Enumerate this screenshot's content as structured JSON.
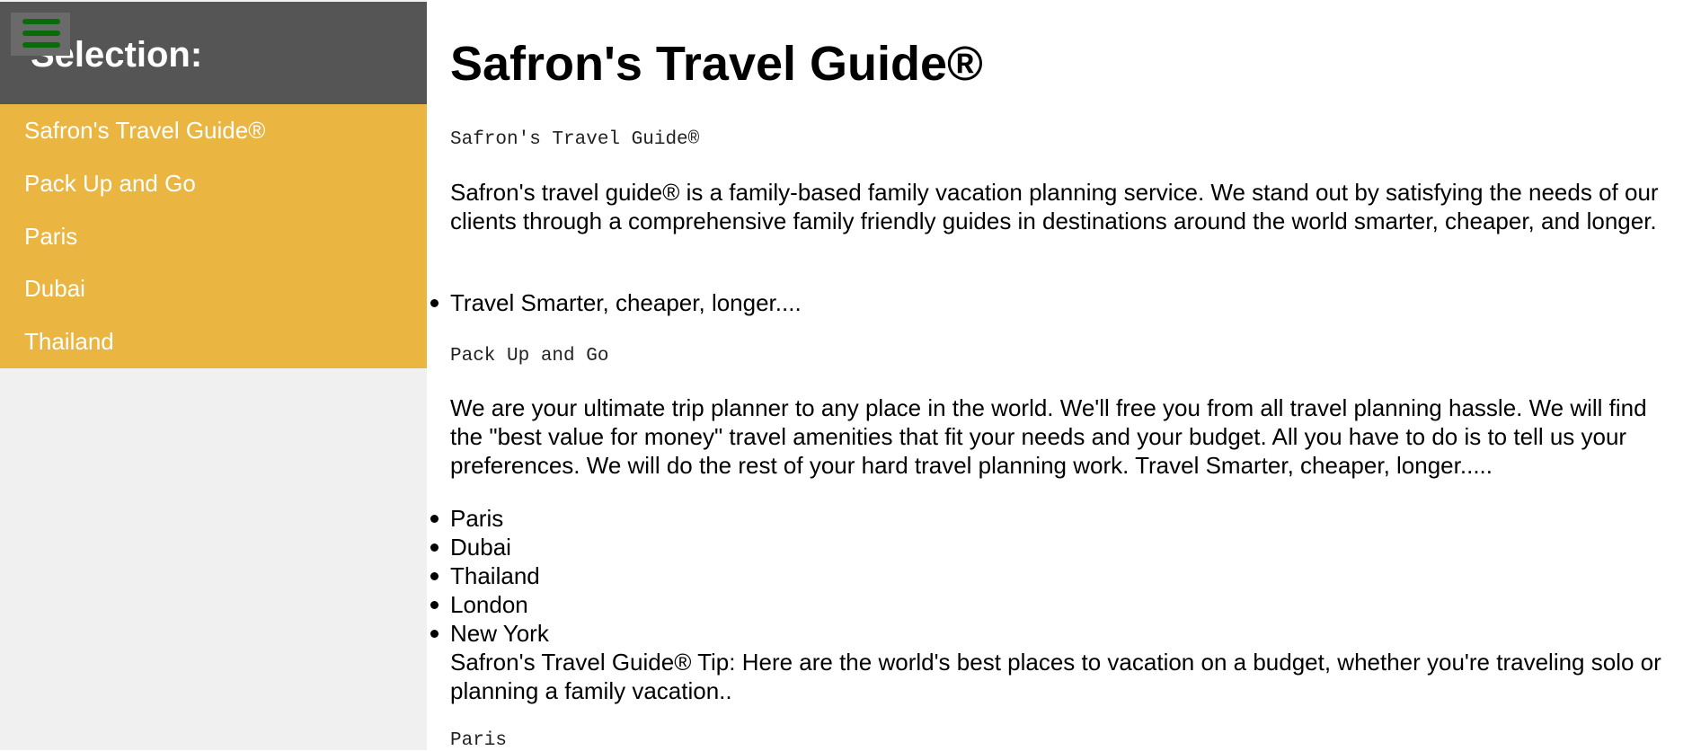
{
  "sidebar": {
    "title": "Selection:",
    "menu_icon": "hamburger-menu-icon",
    "items": [
      {
        "label": "Safron's Travel Guide®"
      },
      {
        "label": "Pack Up and Go"
      },
      {
        "label": "Paris"
      },
      {
        "label": "Dubai"
      },
      {
        "label": "Thailand"
      }
    ]
  },
  "main": {
    "title": "Safron's Travel Guide®",
    "section1_heading": "Safron's Travel Guide®",
    "section1_text": "Safron's travel guide® is a family-based family vacation planning service. We stand out by satisfying the needs of our clients through a comprehensive family friendly guides in destinations around the world smarter, cheaper, and longer.",
    "section1_bullets": [
      "Travel Smarter, cheaper, longer...."
    ],
    "section2_heading": "Pack Up and Go",
    "section2_text": "We are your ultimate trip planner to any place in the world. We'll free you from all travel planning hassle. We will find the \"best value for money\" travel amenities that fit your needs and your budget. All you have to do is to tell us your preferences. We will do the rest of your hard travel planning work. Travel Smarter, cheaper, longer.....",
    "destinations": [
      "Paris",
      "Dubai",
      "Thailand",
      "London",
      "New York"
    ],
    "tip_text": "Safron's Travel Guide® Tip: Here are the world's best places to vacation on a budget, whether you're traveling solo or planning a family vacation..",
    "section3_heading": "Paris"
  },
  "colors": {
    "sidebar_header_bg": "#555555",
    "menu_bg": "#eab541",
    "hamburger_bars": "#0a6b0a",
    "sidebar_bg": "#f0f0f0"
  }
}
